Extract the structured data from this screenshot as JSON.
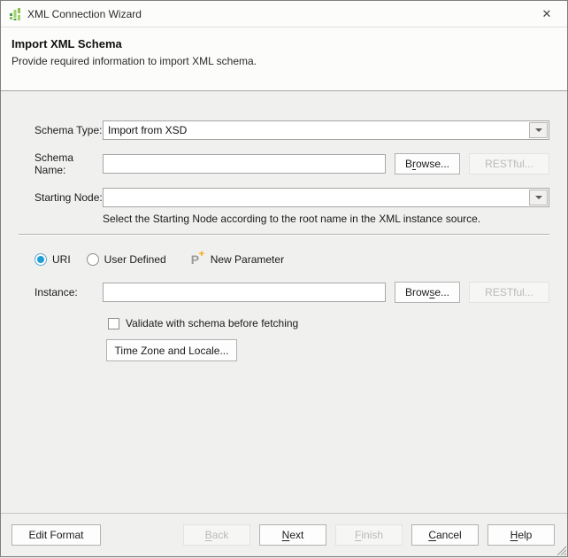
{
  "titlebar": {
    "title": "XML Connection Wizard",
    "close_glyph": "✕"
  },
  "header": {
    "title": "Import XML Schema",
    "subtitle": "Provide required information to import XML schema."
  },
  "form": {
    "schema_type": {
      "label": "Schema Type:",
      "value": "Import from XSD"
    },
    "schema_name": {
      "label": "Schema Name:",
      "value": "",
      "browse": {
        "label": "Browse...",
        "mnemonic": "r"
      },
      "restful": {
        "label": "RESTful...",
        "mnemonic": ""
      }
    },
    "starting_node": {
      "label": "Starting Node:",
      "value": "",
      "hint": "Select the Starting Node according to the root name in the XML instance source."
    },
    "source_mode": {
      "uri_label": "URI",
      "uri_selected": true,
      "user_defined_label": "User Defined",
      "user_defined_selected": false,
      "new_parameter_label": "New Parameter",
      "parameter_icon_letter": "P",
      "parameter_icon_plus": "+"
    },
    "instance": {
      "label": "Instance:",
      "value": "",
      "browse": {
        "label": "Browse...",
        "mnemonic": "s"
      },
      "restful": {
        "label": "RESTful...",
        "mnemonic": ""
      }
    },
    "validate_checkbox": {
      "label": "Validate with schema before fetching",
      "checked": false
    },
    "timezone_button": {
      "label": "Time Zone and Locale...",
      "mnemonic": ""
    }
  },
  "footer": {
    "edit_format": {
      "label": "Edit Format",
      "mnemonic": ""
    },
    "back": {
      "label": "Back",
      "mnemonic": "B",
      "enabled": false
    },
    "next": {
      "label": "Next",
      "mnemonic": "N",
      "enabled": true
    },
    "finish": {
      "label": "Finish",
      "mnemonic": "F",
      "enabled": false
    },
    "cancel": {
      "label": "Cancel",
      "mnemonic": "C",
      "enabled": true
    },
    "help": {
      "label": "Help",
      "mnemonic": "H",
      "enabled": true
    }
  },
  "colors": {
    "icon_green_light": "#9ed36a",
    "icon_green_dark": "#4e9a51",
    "radio_blue": "#1f9dd9",
    "param_orange": "#f7a600",
    "dialog_bg": "#f0f0ee"
  }
}
